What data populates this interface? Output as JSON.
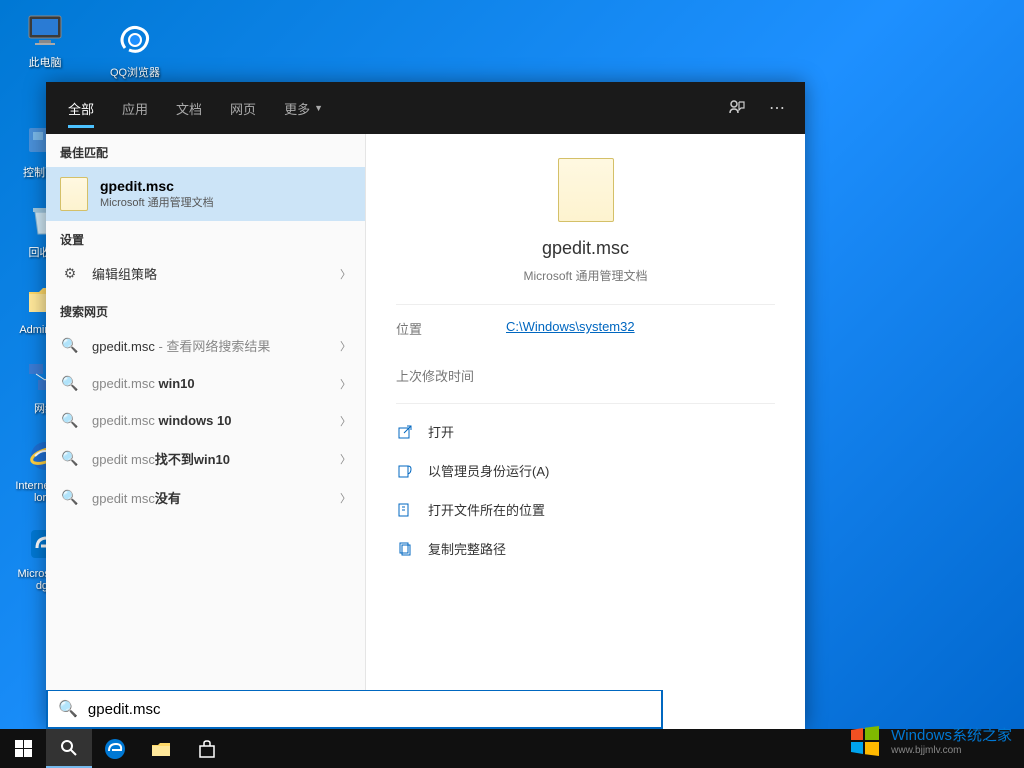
{
  "desktop": {
    "icons": [
      {
        "label": "此电脑"
      },
      {
        "label": "QQ浏览器"
      },
      {
        "label": "控制面板"
      },
      {
        "label": "回收站"
      },
      {
        "label": "Administ..."
      },
      {
        "label": "网络"
      },
      {
        "label": "Internet Explorer"
      },
      {
        "label": "Microsoft Edge"
      }
    ]
  },
  "search": {
    "tabs": [
      "全部",
      "应用",
      "文档",
      "网页",
      "更多"
    ],
    "sections": {
      "best_match": "最佳匹配",
      "settings": "设置",
      "web": "搜索网页"
    },
    "best": {
      "title": "gpedit.msc",
      "subtitle": "Microsoft 通用管理文档"
    },
    "settings_items": [
      {
        "label": "编辑组策略"
      }
    ],
    "web_items": [
      {
        "prefix": "gpedit.msc",
        "suffix": " - 查看网络搜索结果"
      },
      {
        "prefix": "gpedit.msc ",
        "bold": "win10"
      },
      {
        "prefix": "gpedit.msc ",
        "bold": "windows 10"
      },
      {
        "prefix": "gpedit msc",
        "bold": "找不到win10"
      },
      {
        "prefix": "gpedit msc",
        "bold": "没有"
      }
    ],
    "preview": {
      "title": "gpedit.msc",
      "subtitle": "Microsoft 通用管理文档",
      "meta": [
        {
          "label": "位置",
          "value": "C:\\Windows\\system32"
        },
        {
          "label": "上次修改时间",
          "value": ""
        }
      ],
      "actions": [
        "打开",
        "以管理员身份运行(A)",
        "打开文件所在的位置",
        "复制完整路径"
      ]
    },
    "input": "gpedit.msc"
  },
  "watermark": {
    "text": "Windows系统之家",
    "url": "www.bjjmlv.com"
  }
}
